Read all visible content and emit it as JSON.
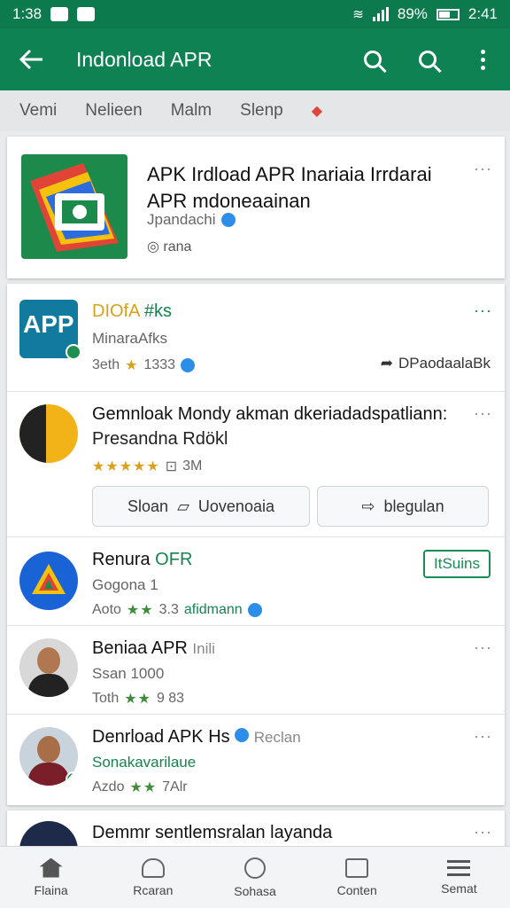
{
  "status_bar": {
    "left_time": "1:38",
    "battery_percent": "89%",
    "time": "2:41"
  },
  "app_bar": {
    "title": "Indonload APR"
  },
  "tabs": [
    {
      "label": "Vemi"
    },
    {
      "label": "Nelieen"
    },
    {
      "label": "Malm"
    },
    {
      "label": "Slenp"
    }
  ],
  "featured": {
    "title": "APK Irdload APR Inariaia Irrdarai APR mdoneaainan",
    "developer": "Jpandachi",
    "meta": "rana",
    "more": "···"
  },
  "list": [
    {
      "title": "DIOfA",
      "title_tag": "#ks",
      "subtitle": "MinaraAfks",
      "meta_prefix": "3eth",
      "rating": "1333",
      "right_label": "DPaodaalaBk",
      "more": "···"
    },
    {
      "title": "Gemnloak Mondy akman dkeriadadspatliann:",
      "subtitle": "Presandna Rdökl",
      "stars": "★★★★★",
      "meta": "3M",
      "more": "···",
      "buttons": {
        "secondary": "Sloan",
        "primary": "Uovenoaia",
        "share": "blegulan"
      }
    },
    {
      "title": "Renura",
      "title_tag": "OFR",
      "subtitle": "Gogona 1",
      "meta_prefix": "Aoto",
      "stars": "★★",
      "rating": "3.3",
      "dev": "afidmann",
      "install_label": "ItSuins"
    },
    {
      "title": "Beniaa APR",
      "title_tag": "Inili",
      "subtitle": "Ssan 1000",
      "meta_prefix": "Toth",
      "stars": "★★",
      "rating": "9 83",
      "more": "···"
    },
    {
      "title": "Denrload APK Hs",
      "title_tag": "Reclan",
      "subtitle": "Sonakavarilaue",
      "meta_prefix": "Azdo",
      "stars": "★★",
      "rating": "7Alr",
      "more": "···"
    }
  ],
  "peek_row": {
    "title": "Demmr",
    "subtitle": "sentlemsralan layanda",
    "more": "···"
  },
  "bottom_nav": [
    {
      "label": "Flaina",
      "icon": "home-icon"
    },
    {
      "label": "Rcaran",
      "icon": "bell-icon"
    },
    {
      "label": "Sohasa",
      "icon": "compass-icon"
    },
    {
      "label": "Conten",
      "icon": "library-icon"
    },
    {
      "label": "Semat",
      "icon": "menu-icon"
    }
  ],
  "colors": {
    "primary": "#0f8254",
    "accent_green": "#15834e",
    "star": "#d9a21e",
    "verified": "#2c8ee8"
  }
}
